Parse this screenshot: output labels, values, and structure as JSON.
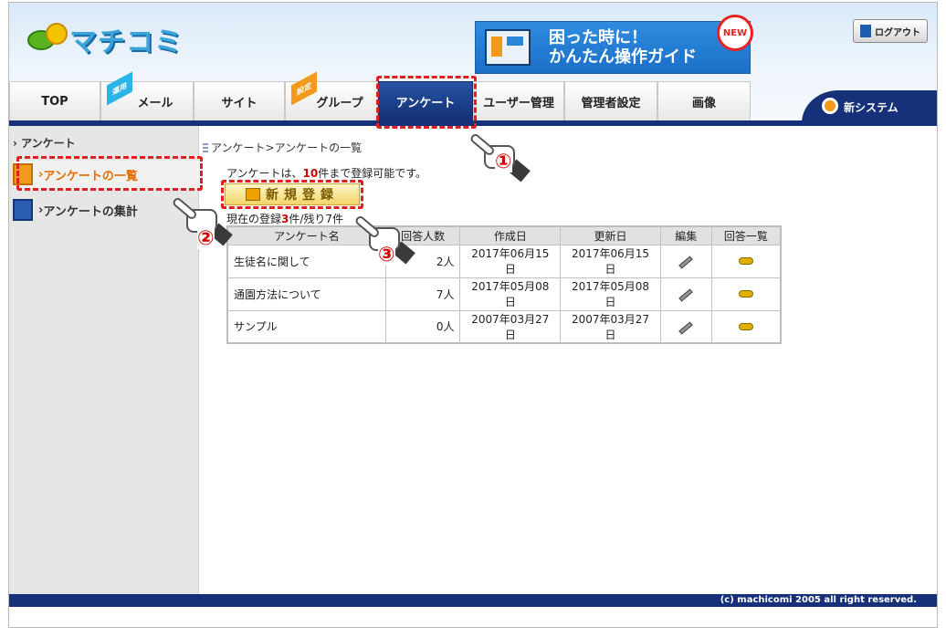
{
  "app": {
    "logo_text": "マチコミ",
    "banner_text_1": "困った時に！",
    "banner_text_2": "かんたん操作ガイド",
    "banner_badge": "NEW",
    "logout_label": "ログアウト",
    "new_system_label": "新システム"
  },
  "nav": {
    "tabs": [
      {
        "label": "TOP",
        "tag": ""
      },
      {
        "label": "メール",
        "tag": "運用"
      },
      {
        "label": "サイト",
        "tag": ""
      },
      {
        "label": "グループ",
        "tag": "設定"
      },
      {
        "label": "アンケート",
        "tag": ""
      },
      {
        "label": "ユーザー管理",
        "tag": ""
      },
      {
        "label": "管理者設定",
        "tag": ""
      },
      {
        "label": "画像",
        "tag": ""
      }
    ]
  },
  "sidebar": {
    "title": "アンケート",
    "items": [
      {
        "label": "アンケートの一覧"
      },
      {
        "label": "アンケートの集計"
      }
    ]
  },
  "main": {
    "breadcrumb": "アンケート>アンケートの一覧",
    "limit_prefix": "アンケートは、",
    "limit_number": "10",
    "limit_suffix": "件まで登録可能です。",
    "new_button_label": "新規登録",
    "count_prefix": "現在の登録",
    "count_number": "3",
    "count_suffix": "件/残り7件",
    "table": {
      "headers": [
        "アンケート名",
        "回答人数",
        "作成日",
        "更新日",
        "編集",
        "回答一覧"
      ],
      "rows": [
        {
          "name": "生徒名に関して",
          "responses": "2人",
          "created": "2017年06月15日",
          "updated": "2017年06月15日"
        },
        {
          "name": "通園方法について",
          "responses": "7人",
          "created": "2017年05月08日",
          "updated": "2017年05月08日"
        },
        {
          "name": "サンプル",
          "responses": "0人",
          "created": "2007年03月27日",
          "updated": "2007年03月27日"
        }
      ]
    }
  },
  "annotations": {
    "marker_1": "①",
    "marker_2": "②",
    "marker_3": "③"
  },
  "footer": {
    "copyright": "(c) machicomi 2005 all right reserved."
  }
}
